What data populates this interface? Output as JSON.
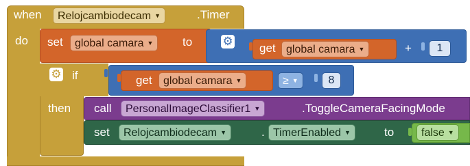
{
  "colors": {
    "event": "#c6a03a",
    "event_border": "#a88228",
    "variables": "#d3652a",
    "variables_pill": "#ebad8a",
    "math": "#3e6fb4",
    "math_pill": "#8eb3e2",
    "component_method": "#7b3c8e",
    "component_pill": "#c8a6d3",
    "component_setter": "#2f6648",
    "component_setter_pill": "#9cc6a8",
    "logic": "#76b84a",
    "logic_pill": "#b8dfa0"
  },
  "event_block": {
    "when_label": "when",
    "component_name": "Relojcambiodecam",
    "event_name": ".Timer",
    "do_label": "do"
  },
  "set_global": {
    "set_label": "set",
    "variable": "global camara",
    "to_label": "to"
  },
  "addition": {
    "get_label": "get",
    "variable": "global camara",
    "operator": "+",
    "operand": "1",
    "mutator_icon": "gear-icon"
  },
  "if_block": {
    "if_label": "if",
    "then_label": "then",
    "mutator_icon": "gear-icon"
  },
  "compare": {
    "get_label": "get",
    "variable": "global camara",
    "operator": "≥",
    "operand": "8"
  },
  "call_block": {
    "call_label": "call",
    "component": "PersonalImageClassifier1",
    "method": ".ToggleCameraFacingMode"
  },
  "set_timer": {
    "set_label": "set",
    "component": "Relojcambiodecam",
    "dot": ".",
    "property": "TimerEnabled",
    "to_label": "to",
    "value": "false"
  }
}
